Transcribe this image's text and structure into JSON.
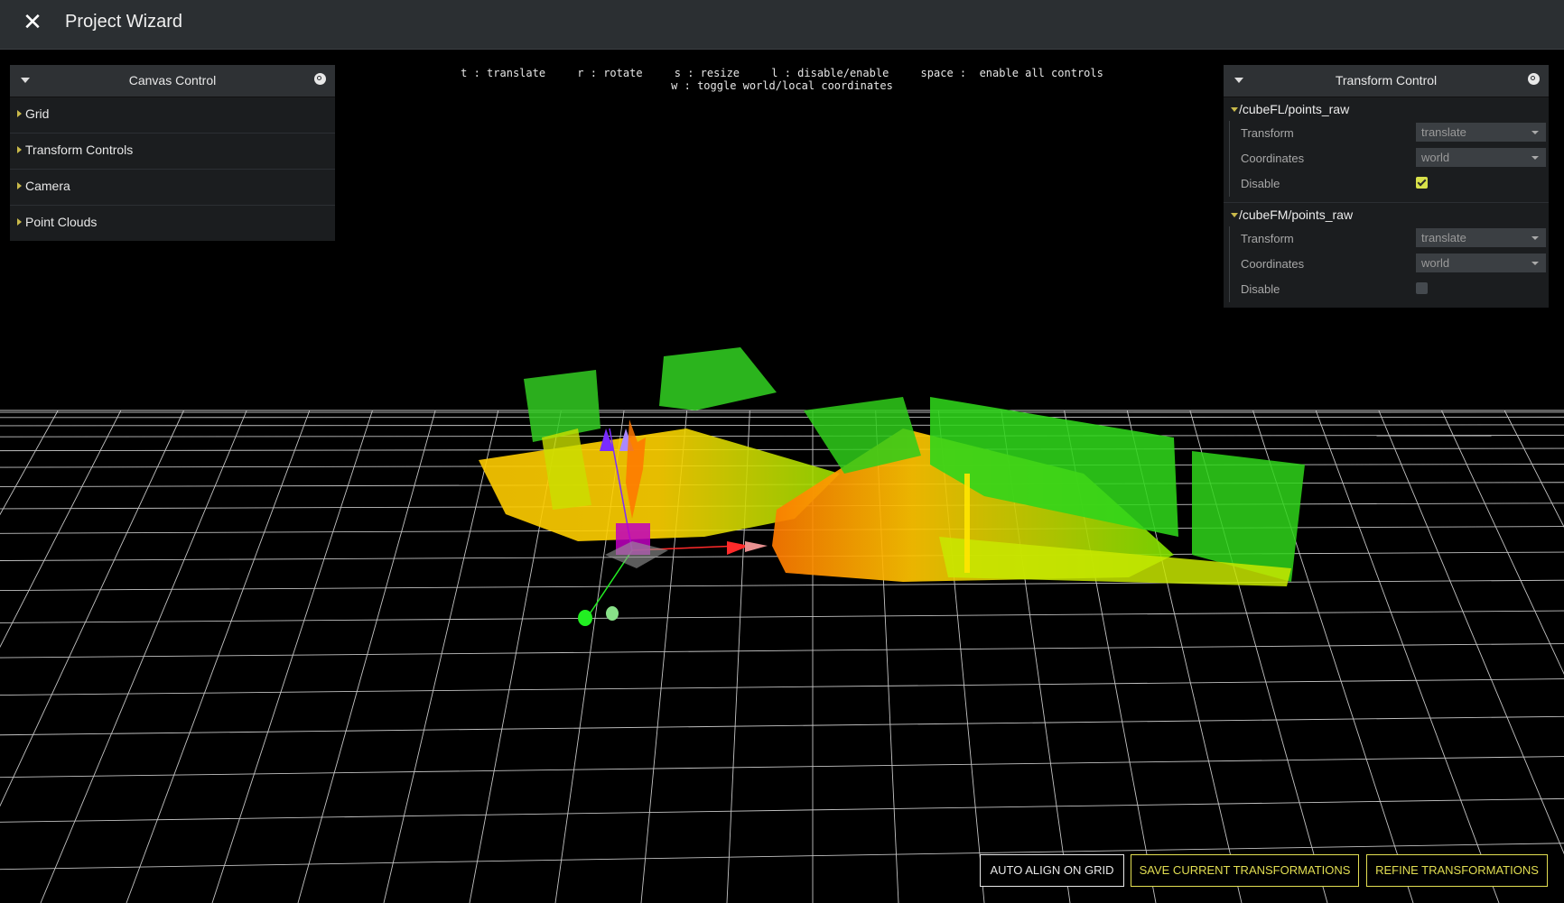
{
  "app": {
    "title": "Project Wizard",
    "close_icon": "close-icon"
  },
  "help": {
    "row1": [
      "t : translate",
      "r : rotate",
      "s : resize",
      "l : disable/enable",
      "space :  enable all controls"
    ],
    "row2": "w : toggle world/local coordinates"
  },
  "canvas_control": {
    "title": "Canvas Control",
    "items": [
      {
        "label": "Grid"
      },
      {
        "label": "Transform Controls"
      },
      {
        "label": "Camera"
      },
      {
        "label": "Point Clouds"
      }
    ]
  },
  "transform_control": {
    "title": "Transform Control",
    "groups": [
      {
        "name": "/cubeFL/points_raw",
        "transform_label": "Transform",
        "transform_value": "translate",
        "coordinates_label": "Coordinates",
        "coordinates_value": "world",
        "disable_label": "Disable",
        "disable_checked": true
      },
      {
        "name": "/cubeFM/points_raw",
        "transform_label": "Transform",
        "transform_value": "translate",
        "coordinates_label": "Coordinates",
        "coordinates_value": "world",
        "disable_label": "Disable",
        "disable_checked": false
      }
    ]
  },
  "actions": {
    "auto_align": "AUTO ALIGN ON GRID",
    "save": "SAVE CURRENT TRANSFORMATIONS",
    "refine": "REFINE TRANSFORMATIONS"
  },
  "colors": {
    "accent": "#e3df52",
    "checkbox_on": "#d8e14a",
    "axis_x": "#ff2a2a",
    "axis_y": "#22ee22",
    "axis_z": "#7a2cff"
  }
}
